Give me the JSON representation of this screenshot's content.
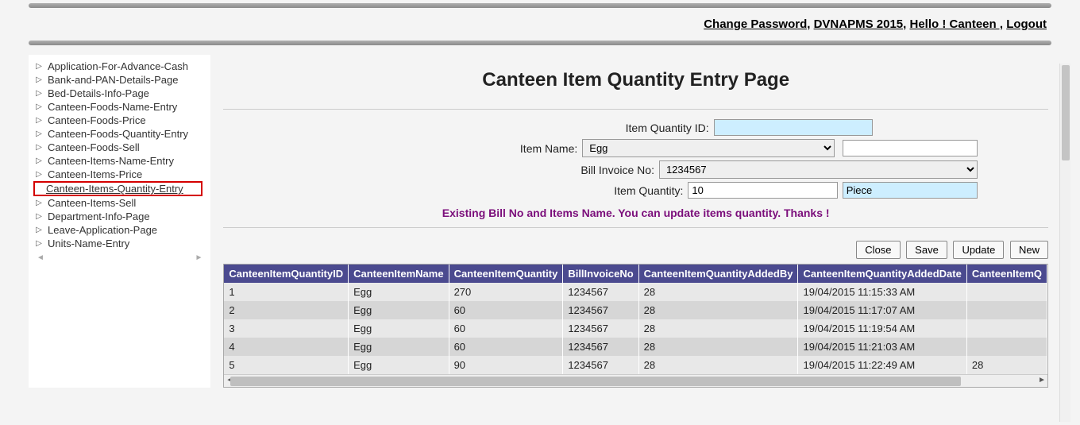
{
  "toplinks": {
    "change_password": "Change Password,",
    "app": "DVNAPMS 2015,",
    "hello": "Hello ! Canteen ,",
    "logout": "Logout"
  },
  "sidebar": {
    "items": [
      "Application-For-Advance-Cash",
      "Bank-and-PAN-Details-Page",
      "Bed-Details-Info-Page",
      "Canteen-Foods-Name-Entry",
      "Canteen-Foods-Price",
      "Canteen-Foods-Quantity-Entry",
      "Canteen-Foods-Sell",
      "Canteen-Items-Name-Entry",
      "Canteen-Items-Price",
      "Canteen-Items-Quantity-Entry",
      "Canteen-Items-Sell",
      "Department-Info-Page",
      "Leave-Application-Page",
      "Units-Name-Entry"
    ],
    "selected_index": 9
  },
  "title": "Canteen Item Quantity Entry Page",
  "form": {
    "qid_label": "Item Quantity ID:",
    "qid_value": "",
    "itemname_label": "Item Name:",
    "itemname_value": "Egg",
    "extra_value": "",
    "bill_label": "Bill Invoice No:",
    "bill_value": "1234567",
    "qty_label": "Item Quantity:",
    "qty_value": "10",
    "unit_value": "Piece",
    "status": "Existing Bill No and Items Name. You can update items quantity. Thanks !"
  },
  "buttons": {
    "close": "Close",
    "save": "Save",
    "update": "Update",
    "neww": "New"
  },
  "grid": {
    "headers": [
      "CanteenItemQuantityID",
      "CanteenItemName",
      "CanteenItemQuantity",
      "BillInvoiceNo",
      "CanteenItemQuantityAddedBy",
      "CanteenItemQuantityAddedDate",
      "CanteenItemQ"
    ],
    "rows": [
      [
        "1",
        "Egg",
        "270",
        "1234567",
        "28",
        "19/04/2015 11:15:33 AM",
        ""
      ],
      [
        "2",
        "Egg",
        "60",
        "1234567",
        "28",
        "19/04/2015 11:17:07 AM",
        ""
      ],
      [
        "3",
        "Egg",
        "60",
        "1234567",
        "28",
        "19/04/2015 11:19:54 AM",
        ""
      ],
      [
        "4",
        "Egg",
        "60",
        "1234567",
        "28",
        "19/04/2015 11:21:03 AM",
        ""
      ],
      [
        "5",
        "Egg",
        "90",
        "1234567",
        "28",
        "19/04/2015 11:22:49 AM",
        "28"
      ]
    ]
  }
}
